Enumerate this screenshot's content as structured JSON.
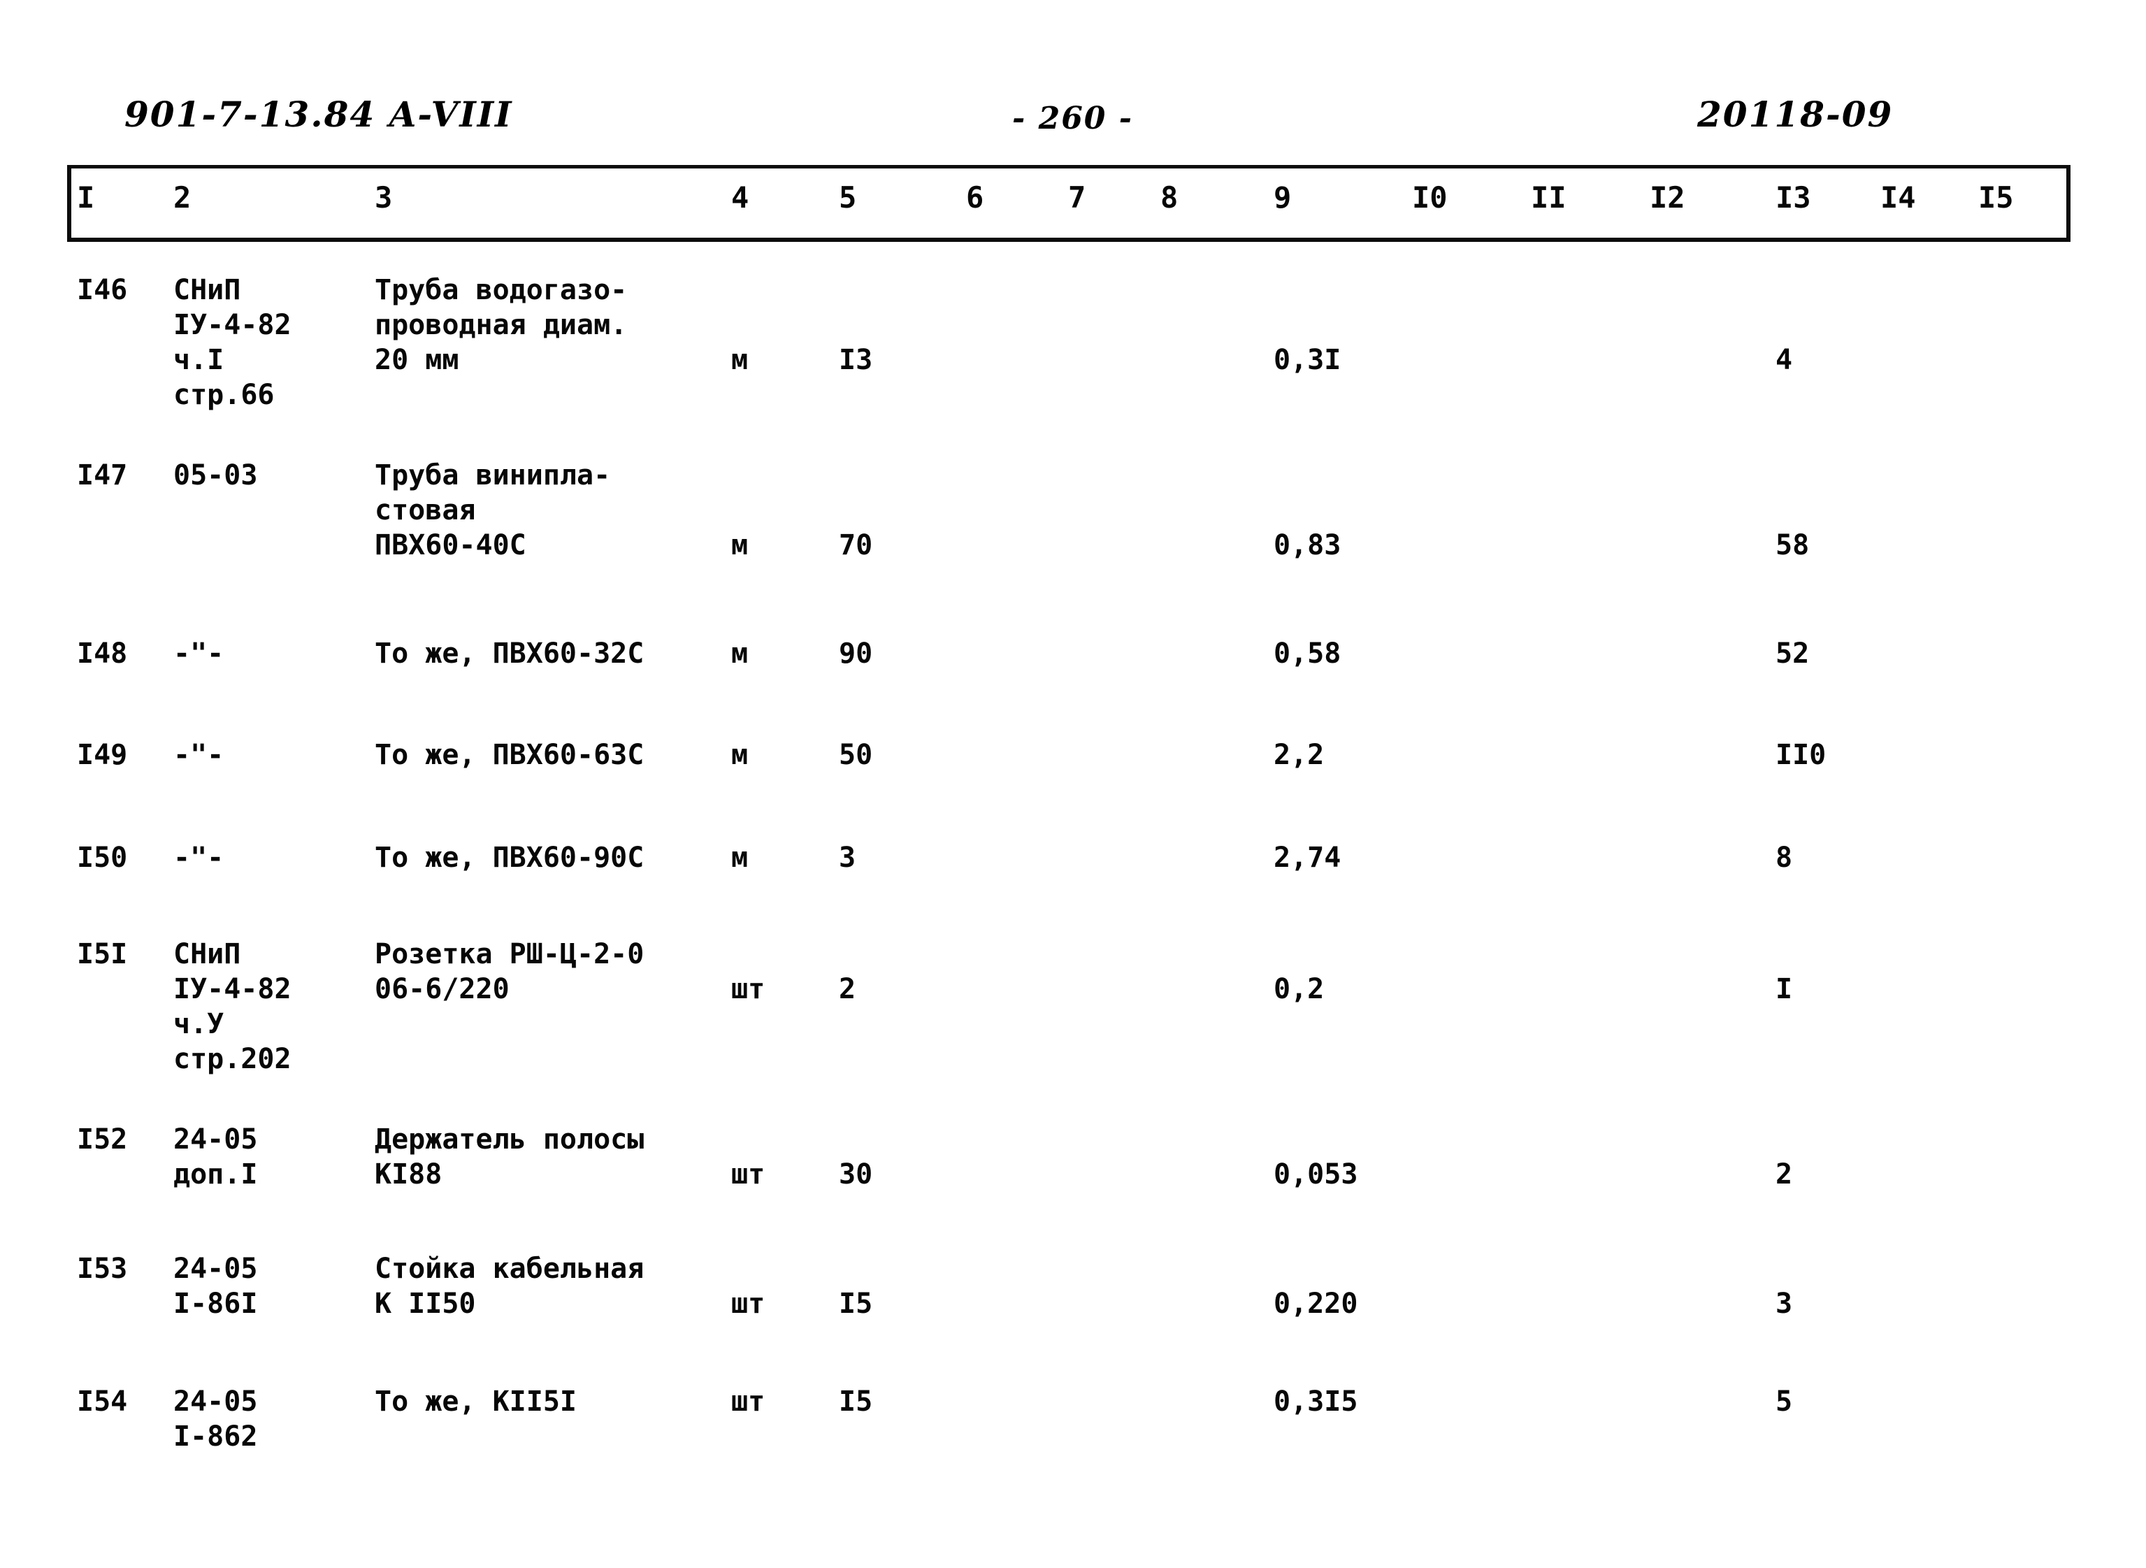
{
  "document": {
    "header_left": "901-7-13.84   A-VIII",
    "header_center": "-  260  -",
    "header_right": "20118-09"
  },
  "table": {
    "column_headers": [
      "I",
      "2",
      "3",
      "4",
      "5",
      "6",
      "7",
      "8",
      "9",
      "I0",
      "II",
      "I2",
      "I3",
      "I4",
      "I5"
    ],
    "rows": [
      {
        "num": "I46",
        "ref": "СНиП\nIУ-4-82\nч.I\nстр.66",
        "name": "Труба водогазо-\nпроводная диам.\n20 мм",
        "unit": "м",
        "qty": "I3",
        "col9": "0,3I",
        "col13": "4"
      },
      {
        "num": "I47",
        "ref": "05-03",
        "name": "Труба винипла-\nстовая\nПВХ60-40С",
        "unit": "м",
        "qty": "70",
        "col9": "0,83",
        "col13": "58"
      },
      {
        "num": "I48",
        "ref": "-\"-",
        "name": "То же, ПВХ60-32С",
        "unit": "м",
        "qty": "90",
        "col9": "0,58",
        "col13": "52"
      },
      {
        "num": "I49",
        "ref": "-\"-",
        "name": "То же, ПВХ60-63С",
        "unit": "м",
        "qty": "50",
        "col9": "2,2",
        "col13": "II0"
      },
      {
        "num": "I50",
        "ref": "-\"-",
        "name": "То же, ПВХ60-90С",
        "unit": "м",
        "qty": "3",
        "col9": "2,74",
        "col13": "8"
      },
      {
        "num": "I5I",
        "ref": "СНиП\nIУ-4-82\nч.У\nстр.202",
        "name": "Розетка РШ-Ц-2-0\n06-6/220",
        "unit": "шт",
        "qty": "2",
        "col9": "0,2",
        "col13": "I"
      },
      {
        "num": "I52",
        "ref": "24-05\nдоп.I",
        "name": "Держатель полосы\nКI88",
        "unit": "шт",
        "qty": "30",
        "col9": "0,053",
        "col13": "2"
      },
      {
        "num": "I53",
        "ref": "24-05\nI-86I",
        "name": "Стойка кабельная\nК II50",
        "unit": "шт",
        "qty": "I5",
        "col9": "0,220",
        "col13": "3"
      },
      {
        "num": "I54",
        "ref": "24-05\nI-862",
        "name": "То же, КII5I",
        "unit": "шт",
        "qty": "I5",
        "col9": "0,3I5",
        "col13": "5"
      }
    ]
  }
}
